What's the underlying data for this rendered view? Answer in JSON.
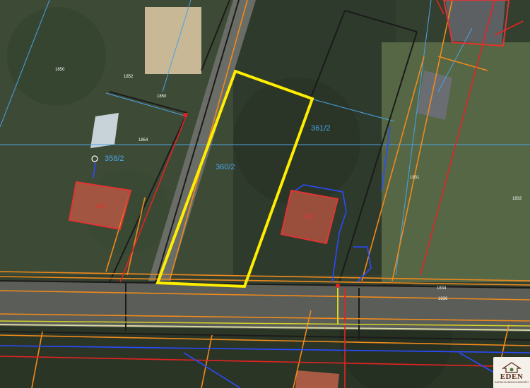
{
  "parcel_labels": {
    "main": "360/2",
    "neighbor_right": "361/2",
    "neighbor_left": "358/2"
  },
  "building_labels": {
    "left": "m1",
    "right": "m2"
  },
  "lot_numbers": [
    "1850",
    "1852",
    "1850",
    "1854",
    "1831",
    "1832",
    "1834",
    "1836"
  ],
  "logo": {
    "name": "EDEN",
    "tagline": "AGENCJA NIERUCHOMOŚCI"
  },
  "colors": {
    "highlight": "#ffee00",
    "parcel_border": "#1b1b1b",
    "cadastral": "#4aa3e8",
    "gas": "#f08a1c",
    "water": "#2a4bff",
    "power": "#e52222",
    "building": "#e03434"
  }
}
